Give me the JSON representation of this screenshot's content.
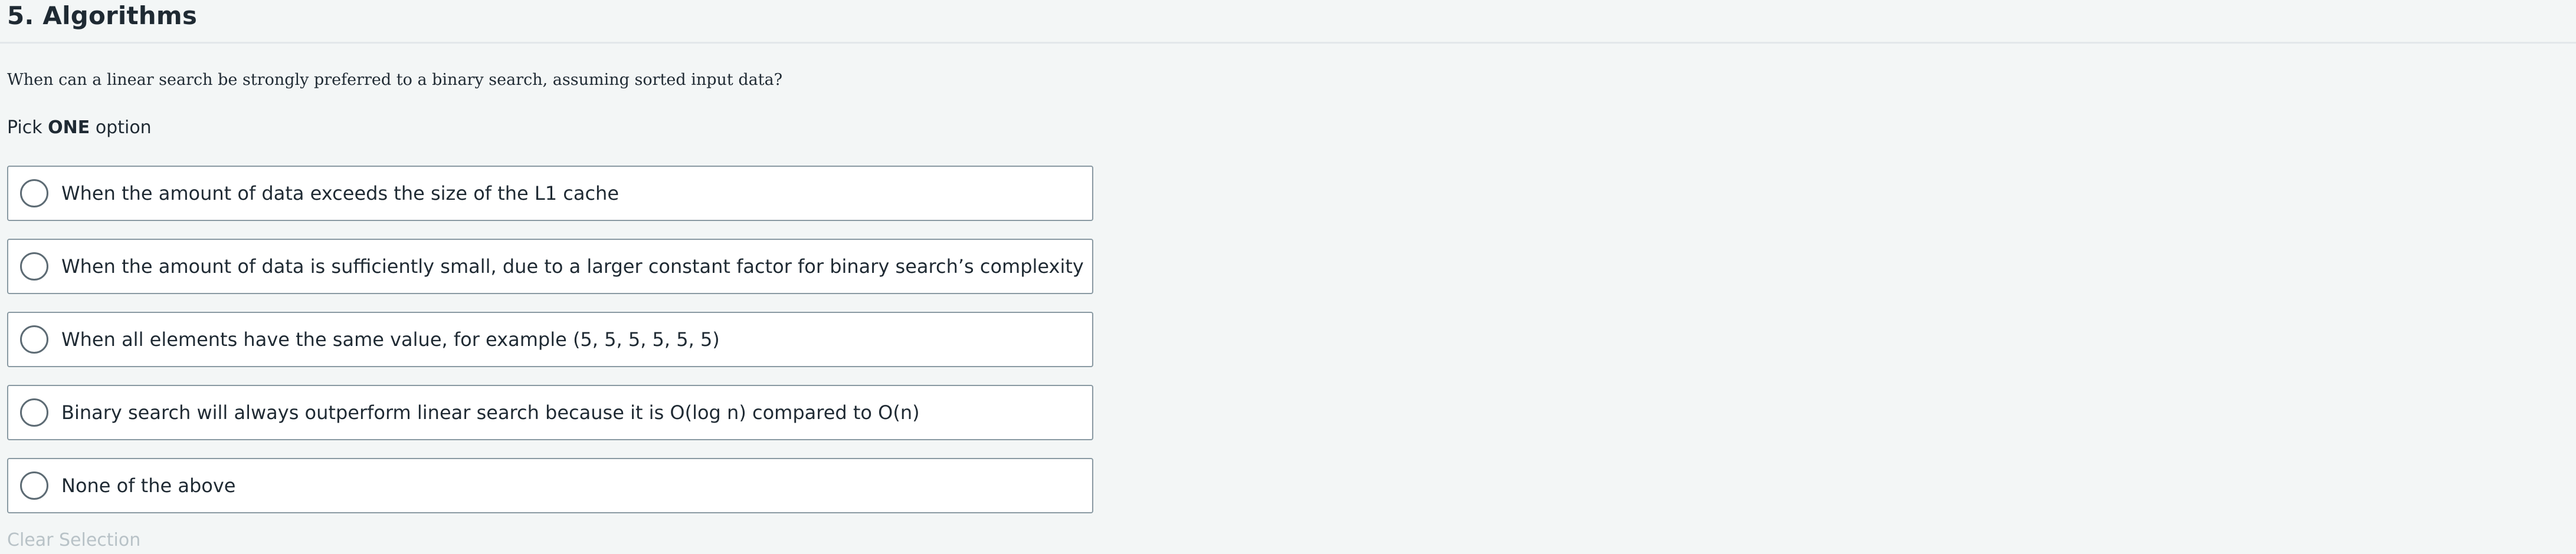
{
  "question": {
    "title": "5. Algorithms",
    "text": "When can a linear search be strongly preferred to a binary search, assuming sorted input data?",
    "instruction_prefix": "Pick ",
    "instruction_emphasis": "ONE",
    "instruction_suffix": " option"
  },
  "options": [
    {
      "label": "When the amount of data exceeds the size of the L1 cache",
      "selected": false
    },
    {
      "label": "When the amount of data is sufficiently small, due to a larger constant factor for binary search’s complexity",
      "selected": false
    },
    {
      "label": "When all elements have the same value, for example (5, 5, 5, 5, 5, 5)",
      "selected": false
    },
    {
      "label": "Binary search will always outperform linear search because it is O(log n) compared to O(n)",
      "selected": false
    },
    {
      "label": "None of the above",
      "selected": false
    }
  ],
  "actions": {
    "clear_selection_label": "Clear Selection"
  },
  "colors": {
    "background": "#f3f6f6",
    "option_border": "#8a9aa3",
    "text": "#1f2a33",
    "disabled_text": "#b8c2c7"
  }
}
